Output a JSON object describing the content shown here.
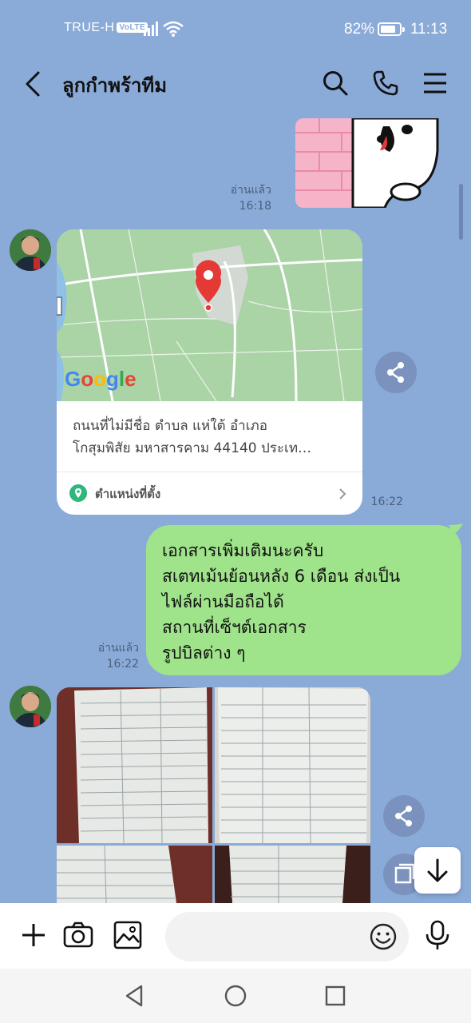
{
  "status_bar": {
    "carrier": "TRUE-H",
    "volte": "VoLTE",
    "battery_percent": "82%",
    "battery_level": 0.82,
    "time": "11:13"
  },
  "header": {
    "title": "ลูกกำพร้าทีม",
    "icons": [
      "back-icon",
      "search-icon",
      "phone-icon",
      "menu-icon"
    ]
  },
  "messages": [
    {
      "type": "sticker",
      "side": "right",
      "read": "อ่านแล้ว",
      "time": "16:18"
    },
    {
      "type": "location",
      "side": "left",
      "map_logo": "Google",
      "address_line1": "ถนนที่ไม่มีชื่อ ตำบล แห่ใต้ อำเภอ",
      "address_line2": "โกสุมพิสัย มหาสารคาม 44140 ประเท…",
      "location_label": "ตำแหน่งที่ตั้ง",
      "time": "16:22"
    },
    {
      "type": "text",
      "side": "right",
      "lines": [
        "เอกสารเพิ่มเติมนะครับ",
        "สเตทเม้นย้อนหลัง 6 เดือน ส่งเป็น",
        "ไฟล์ผ่านมือถือได้",
        "สถานที่เซ็ฯต์เอกสาร",
        "รูปบิลต่าง ๆ"
      ],
      "read": "อ่านแล้ว",
      "time": "16:22"
    },
    {
      "type": "photos",
      "side": "left",
      "count": 4
    }
  ],
  "colors": {
    "chat_background": "#8aaad8",
    "my_bubble": "#9fe38a",
    "map_pin": "#e53935",
    "location_icon": "#2eb67d"
  },
  "input": {
    "placeholder": "",
    "icons": [
      "plus-icon",
      "camera-icon",
      "image-icon",
      "emoji-icon",
      "microphone-icon"
    ]
  },
  "nav_bar": {
    "icons": [
      "nav-back-icon",
      "nav-home-icon",
      "nav-recents-icon"
    ]
  }
}
